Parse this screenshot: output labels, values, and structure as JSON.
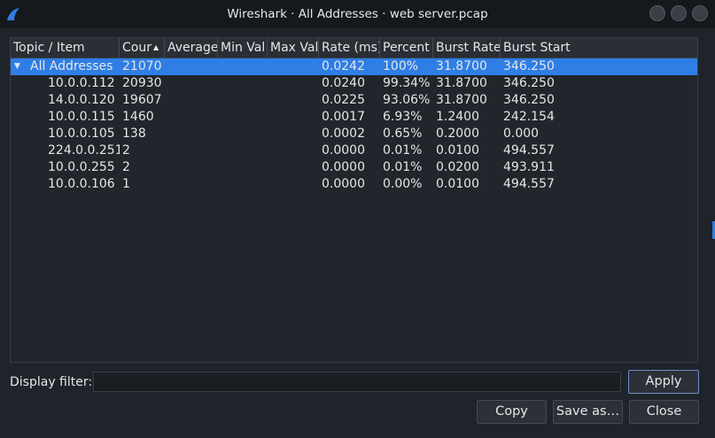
{
  "window": {
    "title": "Wireshark · All Addresses · web server.pcap",
    "accent": "#2f7ee6"
  },
  "table": {
    "columns": [
      "Topic / Item",
      "Cour",
      "Average",
      "Min Val",
      "Max Val",
      "Rate (ms)",
      "Percent",
      "Burst Rate",
      "Burst Start"
    ],
    "sorted_column": "Cour",
    "rows": [
      {
        "topic": "All Addresses",
        "count": "21070",
        "average": "",
        "min": "",
        "max": "",
        "rate": "0.0242",
        "percent": "100%",
        "burst_rate": "31.8700",
        "burst_start": "346.250",
        "expanded": true,
        "selected": true
      },
      {
        "topic": "10.0.0.112",
        "count": "20930",
        "average": "",
        "min": "",
        "max": "",
        "rate": "0.0240",
        "percent": "99.34%",
        "burst_rate": "31.8700",
        "burst_start": "346.250"
      },
      {
        "topic": "14.0.0.120",
        "count": "19607",
        "average": "",
        "min": "",
        "max": "",
        "rate": "0.0225",
        "percent": "93.06%",
        "burst_rate": "31.8700",
        "burst_start": "346.250"
      },
      {
        "topic": "10.0.0.115",
        "count": "1460",
        "average": "",
        "min": "",
        "max": "",
        "rate": "0.0017",
        "percent": "6.93%",
        "burst_rate": "1.2400",
        "burst_start": "242.154"
      },
      {
        "topic": "10.0.0.105",
        "count": "138",
        "average": "",
        "min": "",
        "max": "",
        "rate": "0.0002",
        "percent": "0.65%",
        "burst_rate": "0.2000",
        "burst_start": "0.000"
      },
      {
        "topic": "224.0.0.251",
        "count": "2",
        "average": "",
        "min": "",
        "max": "",
        "rate": "0.0000",
        "percent": "0.01%",
        "burst_rate": "0.0100",
        "burst_start": "494.557"
      },
      {
        "topic": "10.0.0.255",
        "count": "2",
        "average": "",
        "min": "",
        "max": "",
        "rate": "0.0000",
        "percent": "0.01%",
        "burst_rate": "0.0200",
        "burst_start": "493.911"
      },
      {
        "topic": "10.0.0.106",
        "count": "1",
        "average": "",
        "min": "",
        "max": "",
        "rate": "0.0000",
        "percent": "0.00%",
        "burst_rate": "0.0100",
        "burst_start": "494.557"
      }
    ]
  },
  "filter": {
    "label": "Display filter:",
    "value": "",
    "apply_label": "Apply"
  },
  "buttons": {
    "copy": "Copy",
    "save_as": "Save as…",
    "close": "Close"
  }
}
